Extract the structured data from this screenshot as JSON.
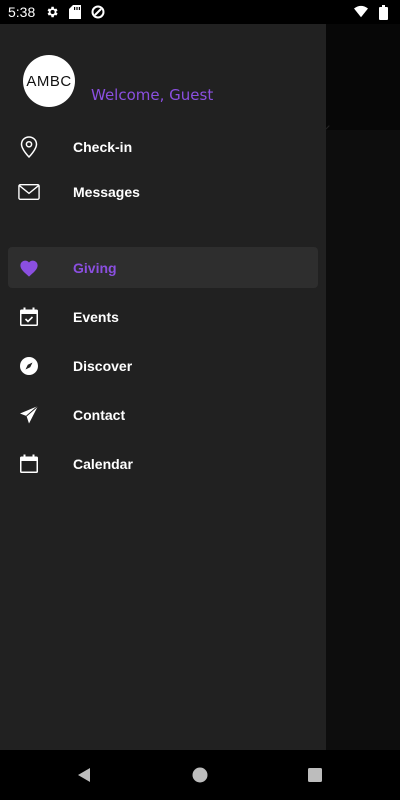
{
  "status_bar": {
    "time": "5:38",
    "icons_left": [
      "gear-icon",
      "sd-card-icon",
      "sync-icon"
    ],
    "icons_right": [
      "wifi-icon",
      "battery-icon"
    ]
  },
  "drawer": {
    "avatar_text": "AMBC",
    "welcome_text": "Welcome, Guest",
    "accent_color": "#8b4fe0",
    "top_items": [
      {
        "label": "Check-in",
        "icon": "location-pin-icon"
      },
      {
        "label": "Messages",
        "icon": "mail-icon"
      }
    ],
    "items": [
      {
        "label": "Giving",
        "icon": "heart-icon",
        "active": true
      },
      {
        "label": "Events",
        "icon": "calendar-check-icon"
      },
      {
        "label": "Discover",
        "icon": "compass-icon"
      },
      {
        "label": "Contact",
        "icon": "send-icon"
      },
      {
        "label": "Calendar",
        "icon": "calendar-icon"
      }
    ]
  },
  "nav_bar": {
    "icons": [
      "back-icon",
      "home-icon",
      "recents-icon"
    ]
  }
}
